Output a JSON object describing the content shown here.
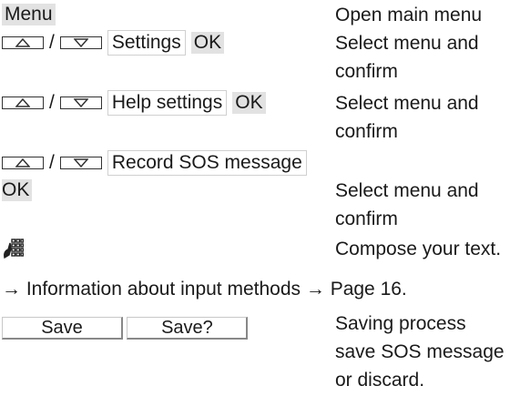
{
  "steps": [
    {
      "left_grey": "Menu",
      "desc": [
        "Open main menu"
      ]
    },
    {
      "menu": "Settings",
      "ok": "OK",
      "desc": [
        "Select menu and",
        "confirm"
      ]
    },
    {
      "menu": "Help settings",
      "ok": "OK",
      "desc": [
        "Select menu and",
        "confirm"
      ]
    },
    {
      "menu": "Record SOS message"
    },
    {
      "left_grey": "OK",
      "desc": [
        "Select menu and",
        "confirm"
      ]
    },
    {
      "icon": "keypad-icon",
      "desc": [
        "Compose your text."
      ]
    }
  ],
  "slash": "/",
  "info_line": "→ Information about input methods → Page 16.",
  "softkeys": [
    {
      "label": "Save"
    },
    {
      "label": "Save?"
    }
  ],
  "softkey_desc": [
    "Saving process",
    "save SOS message",
    "or discard."
  ]
}
